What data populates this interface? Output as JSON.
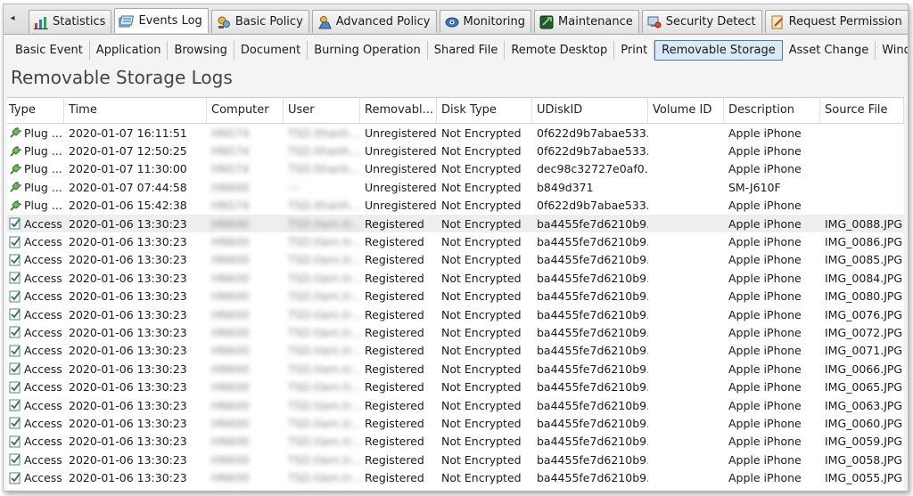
{
  "nav": {
    "scroll_left_glyph": "◂"
  },
  "tabs": [
    {
      "label": "Statistics",
      "icon": "chart-icon",
      "active": false
    },
    {
      "label": "Events Log",
      "icon": "events-log-icon",
      "active": true
    },
    {
      "label": "Basic Policy",
      "icon": "basic-policy-icon",
      "active": false
    },
    {
      "label": "Advanced Policy",
      "icon": "advanced-policy-icon",
      "active": false
    },
    {
      "label": "Monitoring",
      "icon": "monitoring-icon",
      "active": false
    },
    {
      "label": "Maintenance",
      "icon": "maintenance-icon",
      "active": false
    },
    {
      "label": "Security Detect",
      "icon": "security-detect-icon",
      "active": false
    },
    {
      "label": "Request Permission",
      "icon": "request-permission-icon",
      "active": false
    }
  ],
  "subtabs": [
    {
      "label": "Basic Event"
    },
    {
      "label": "Application"
    },
    {
      "label": "Browsing"
    },
    {
      "label": "Document"
    },
    {
      "label": "Burning Operation"
    },
    {
      "label": "Shared File"
    },
    {
      "label": "Remote Desktop"
    },
    {
      "label": "Print"
    },
    {
      "label": "Removable Storage",
      "active": true
    },
    {
      "label": "Asset Change"
    },
    {
      "label": "Windows Sys"
    }
  ],
  "page": {
    "title": "Removable Storage Logs"
  },
  "table": {
    "columns": [
      "Type",
      "Time",
      "Computer",
      "User",
      "Removabl...",
      "Disk Type",
      "UDiskID",
      "Volume ID",
      "Description",
      "Source File"
    ],
    "rows": [
      {
        "type_icon": "plug-icon",
        "type": "Plug ...",
        "time": "2020-01-07 16:11:51",
        "computer": "HN574",
        "user": "TSD.lthanh...",
        "removable": "Unregistered",
        "disk_type": "Not Encrypted",
        "udisk_id": "0f622d9b7abae533...",
        "volume_id": "",
        "description": "Apple iPhone",
        "source_file": ""
      },
      {
        "type_icon": "plug-icon",
        "type": "Plug ...",
        "time": "2020-01-07 12:50:25",
        "computer": "HN574",
        "user": "TSD.lthanh...",
        "removable": "Unregistered",
        "disk_type": "Not Encrypted",
        "udisk_id": "0f622d9b7abae533...",
        "volume_id": "",
        "description": "Apple iPhone",
        "source_file": ""
      },
      {
        "type_icon": "plug-icon",
        "type": "Plug ...",
        "time": "2020-01-07 11:30:00",
        "computer": "HN574",
        "user": "TSD.lthanh...",
        "removable": "Unregistered",
        "disk_type": "Not Encrypted",
        "udisk_id": "dec98c32727e0af0...",
        "volume_id": "",
        "description": "Apple iPhone",
        "source_file": ""
      },
      {
        "type_icon": "plug-icon",
        "type": "Plug ...",
        "time": "2020-01-07 07:44:58",
        "computer": "HN600",
        "user": "---",
        "removable": "Unregistered",
        "disk_type": "Not Encrypted",
        "udisk_id": "b849d371",
        "volume_id": "",
        "description": "SM-J610F",
        "source_file": ""
      },
      {
        "type_icon": "plug-icon",
        "type": "Plug ...",
        "time": "2020-01-06 15:42:38",
        "computer": "HN574",
        "user": "TSD.lthanh...",
        "removable": "Unregistered",
        "disk_type": "Not Encrypted",
        "udisk_id": "0f622d9b7abae533...",
        "volume_id": "",
        "description": "Apple iPhone",
        "source_file": ""
      },
      {
        "type_icon": "access-icon",
        "type": "Access",
        "time": "2020-01-06 13:30:23",
        "computer": "HN600",
        "user": "TSD.tlam.tr...",
        "removable": "Registered",
        "disk_type": "Not Encrypted",
        "udisk_id": "ba4455fe7d6210b9...",
        "volume_id": "",
        "description": "Apple iPhone",
        "source_file": "IMG_0088.JPG"
      },
      {
        "type_icon": "access-icon",
        "type": "Access",
        "time": "2020-01-06 13:30:23",
        "computer": "HN600",
        "user": "TSD.tlam.tr...",
        "removable": "Registered",
        "disk_type": "Not Encrypted",
        "udisk_id": "ba4455fe7d6210b9...",
        "volume_id": "",
        "description": "Apple iPhone",
        "source_file": "IMG_0086.JPG"
      },
      {
        "type_icon": "access-icon",
        "type": "Access",
        "time": "2020-01-06 13:30:23",
        "computer": "HN600",
        "user": "TSD.tlam.tr...",
        "removable": "Registered",
        "disk_type": "Not Encrypted",
        "udisk_id": "ba4455fe7d6210b9...",
        "volume_id": "",
        "description": "Apple iPhone",
        "source_file": "IMG_0085.JPG"
      },
      {
        "type_icon": "access-icon",
        "type": "Access",
        "time": "2020-01-06 13:30:23",
        "computer": "HN600",
        "user": "TSD.tlam.tr...",
        "removable": "Registered",
        "disk_type": "Not Encrypted",
        "udisk_id": "ba4455fe7d6210b9...",
        "volume_id": "",
        "description": "Apple iPhone",
        "source_file": "IMG_0084.JPG"
      },
      {
        "type_icon": "access-icon",
        "type": "Access",
        "time": "2020-01-06 13:30:23",
        "computer": "HN600",
        "user": "TSD.tlam.tr...",
        "removable": "Registered",
        "disk_type": "Not Encrypted",
        "udisk_id": "ba4455fe7d6210b9...",
        "volume_id": "",
        "description": "Apple iPhone",
        "source_file": "IMG_0080.JPG"
      },
      {
        "type_icon": "access-icon",
        "type": "Access",
        "time": "2020-01-06 13:30:23",
        "computer": "HN600",
        "user": "TSD.tlam.tr...",
        "removable": "Registered",
        "disk_type": "Not Encrypted",
        "udisk_id": "ba4455fe7d6210b9...",
        "volume_id": "",
        "description": "Apple iPhone",
        "source_file": "IMG_0076.JPG"
      },
      {
        "type_icon": "access-icon",
        "type": "Access",
        "time": "2020-01-06 13:30:23",
        "computer": "HN600",
        "user": "TSD.tlam.tr...",
        "removable": "Registered",
        "disk_type": "Not Encrypted",
        "udisk_id": "ba4455fe7d6210b9...",
        "volume_id": "",
        "description": "Apple iPhone",
        "source_file": "IMG_0072.JPG"
      },
      {
        "type_icon": "access-icon",
        "type": "Access",
        "time": "2020-01-06 13:30:23",
        "computer": "HN600",
        "user": "TSD.tlam.tr...",
        "removable": "Registered",
        "disk_type": "Not Encrypted",
        "udisk_id": "ba4455fe7d6210b9...",
        "volume_id": "",
        "description": "Apple iPhone",
        "source_file": "IMG_0071.JPG"
      },
      {
        "type_icon": "access-icon",
        "type": "Access",
        "time": "2020-01-06 13:30:23",
        "computer": "HN600",
        "user": "TSD.tlam.tr...",
        "removable": "Registered",
        "disk_type": "Not Encrypted",
        "udisk_id": "ba4455fe7d6210b9...",
        "volume_id": "",
        "description": "Apple iPhone",
        "source_file": "IMG_0066.JPG"
      },
      {
        "type_icon": "access-icon",
        "type": "Access",
        "time": "2020-01-06 13:30:23",
        "computer": "HN600",
        "user": "TSD.tlam.tr...",
        "removable": "Registered",
        "disk_type": "Not Encrypted",
        "udisk_id": "ba4455fe7d6210b9...",
        "volume_id": "",
        "description": "Apple iPhone",
        "source_file": "IMG_0065.JPG"
      },
      {
        "type_icon": "access-icon",
        "type": "Access",
        "time": "2020-01-06 13:30:23",
        "computer": "HN600",
        "user": "TSD.tlam.tr...",
        "removable": "Registered",
        "disk_type": "Not Encrypted",
        "udisk_id": "ba4455fe7d6210b9...",
        "volume_id": "",
        "description": "Apple iPhone",
        "source_file": "IMG_0063.JPG"
      },
      {
        "type_icon": "access-icon",
        "type": "Access",
        "time": "2020-01-06 13:30:23",
        "computer": "HN600",
        "user": "TSD.tlam.tr...",
        "removable": "Registered",
        "disk_type": "Not Encrypted",
        "udisk_id": "ba4455fe7d6210b9...",
        "volume_id": "",
        "description": "Apple iPhone",
        "source_file": "IMG_0060.JPG"
      },
      {
        "type_icon": "access-icon",
        "type": "Access",
        "time": "2020-01-06 13:30:23",
        "computer": "HN600",
        "user": "TSD.tlam.tr...",
        "removable": "Registered",
        "disk_type": "Not Encrypted",
        "udisk_id": "ba4455fe7d6210b9...",
        "volume_id": "",
        "description": "Apple iPhone",
        "source_file": "IMG_0059.JPG"
      },
      {
        "type_icon": "access-icon",
        "type": "Access",
        "time": "2020-01-06 13:30:23",
        "computer": "HN600",
        "user": "TSD.tlam.tr...",
        "removable": "Registered",
        "disk_type": "Not Encrypted",
        "udisk_id": "ba4455fe7d6210b9...",
        "volume_id": "",
        "description": "Apple iPhone",
        "source_file": "IMG_0058.JPG"
      },
      {
        "type_icon": "access-icon",
        "type": "Access",
        "time": "2020-01-06 13:30:23",
        "computer": "HN600",
        "user": "TSD.tlam.tr...",
        "removable": "Registered",
        "disk_type": "Not Encrypted",
        "udisk_id": "ba4455fe7d6210b9...",
        "volume_id": "",
        "description": "Apple iPhone",
        "source_file": "IMG_0055.JPG"
      }
    ],
    "selected_row_index": 5
  },
  "colors": {
    "active_subtab_border": "#3c7fb1",
    "active_subtab_bg": "#dbe8f5",
    "selected_row_bg": "#eeeeee"
  }
}
